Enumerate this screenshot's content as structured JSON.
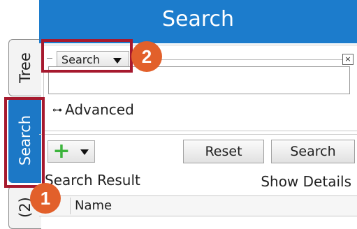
{
  "header": {
    "title": "Search"
  },
  "tabs": [
    {
      "label": "Tree"
    },
    {
      "label": "Search"
    },
    {
      "label": "(2)"
    }
  ],
  "search_panel": {
    "mode_select": "Search",
    "close_glyph": "×",
    "query_value": "",
    "advanced_label": "Advanced"
  },
  "toolbar": {
    "reset_label": "Reset",
    "search_label": "Search"
  },
  "results": {
    "title": "Search Result",
    "show_details_label": "Show Details",
    "columns": [
      "Name"
    ]
  },
  "callouts": [
    {
      "number": "1"
    },
    {
      "number": "2"
    }
  ],
  "colors": {
    "accent": "#1c7ccc",
    "callout": "#a6192e",
    "badge": "#e2602b"
  }
}
